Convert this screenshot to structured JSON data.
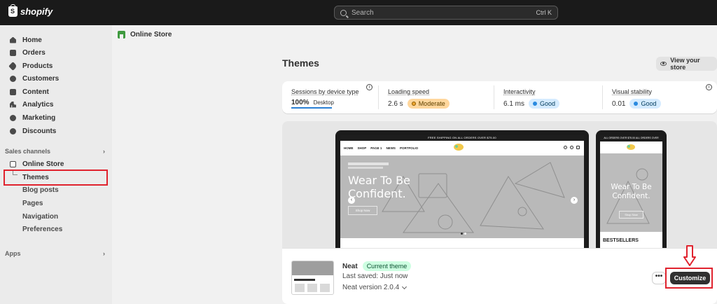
{
  "topbar": {
    "logo_text": "shopify",
    "search_placeholder": "Search",
    "search_shortcut": "Ctrl K"
  },
  "sidebar": {
    "items": [
      {
        "label": "Home",
        "icon": "home-icon"
      },
      {
        "label": "Orders",
        "icon": "orders-icon"
      },
      {
        "label": "Products",
        "icon": "tag-icon"
      },
      {
        "label": "Customers",
        "icon": "person-icon"
      },
      {
        "label": "Content",
        "icon": "content-icon"
      },
      {
        "label": "Analytics",
        "icon": "analytics-icon"
      },
      {
        "label": "Marketing",
        "icon": "marketing-icon"
      },
      {
        "label": "Discounts",
        "icon": "discount-icon"
      }
    ],
    "sales_channels_label": "Sales channels",
    "online_store_label": "Online Store",
    "sub_items": [
      "Themes",
      "Blog posts",
      "Pages",
      "Navigation",
      "Preferences"
    ],
    "apps_label": "Apps"
  },
  "main": {
    "breadcrumb": "Online Store",
    "title": "Themes",
    "view_store_label": "View your store",
    "metrics": [
      {
        "label": "Sessions by device type",
        "value": "100%",
        "sub": "Desktop"
      },
      {
        "label": "Loading speed",
        "value": "2.6 s",
        "badge": "Moderate"
      },
      {
        "label": "Interactivity",
        "value": "6.1 ms",
        "badge": "Good"
      },
      {
        "label": "Visual stability",
        "value": "0.01",
        "badge": "Good"
      }
    ],
    "preview": {
      "promo_text": "FREE SHIPPING ON ALL ORDERS OVER $75.00",
      "nav_links": [
        "HOME",
        "SHOP",
        "PAGE 1",
        "NEWS",
        "PORTFOLIO"
      ],
      "hero_line1": "Wear To Be",
      "hero_line2": "Confident.",
      "shop_button": "Shop Now",
      "phone_promo": "ALL ORDERS OVER $75.00     ALL ORDERS OVER",
      "phone_bestsellers": "BESTSELLERS"
    },
    "theme": {
      "name": "Neat",
      "status_badge": "Current theme",
      "last_saved": "Last saved: Just now",
      "version": "Neat version 2.0.4",
      "more_label": "•••",
      "customize_label": "Customize"
    }
  },
  "colors": {
    "topbar": "#1a1a1a",
    "highlight": "#e0232e",
    "good_badge": "#d5ebff",
    "moderate_badge": "#ffd79d",
    "current_badge": "#cdfee1"
  }
}
